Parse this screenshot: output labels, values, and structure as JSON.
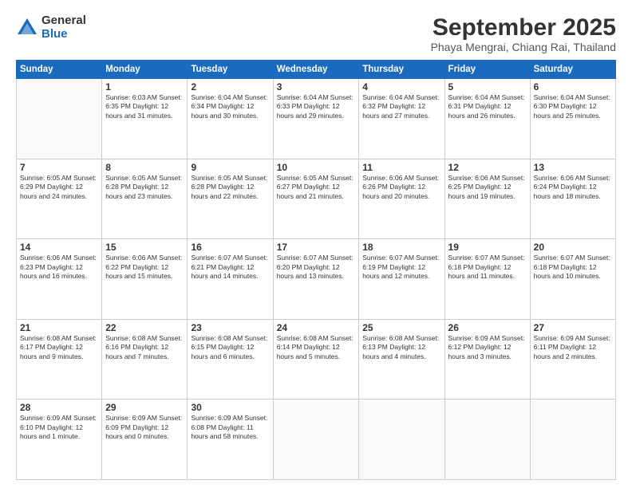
{
  "logo": {
    "general": "General",
    "blue": "Blue"
  },
  "header": {
    "month": "September 2025",
    "location": "Phaya Mengrai, Chiang Rai, Thailand"
  },
  "weekdays": [
    "Sunday",
    "Monday",
    "Tuesday",
    "Wednesday",
    "Thursday",
    "Friday",
    "Saturday"
  ],
  "weeks": [
    [
      {
        "day": "",
        "detail": ""
      },
      {
        "day": "1",
        "detail": "Sunrise: 6:03 AM\nSunset: 6:35 PM\nDaylight: 12 hours\nand 31 minutes."
      },
      {
        "day": "2",
        "detail": "Sunrise: 6:04 AM\nSunset: 6:34 PM\nDaylight: 12 hours\nand 30 minutes."
      },
      {
        "day": "3",
        "detail": "Sunrise: 6:04 AM\nSunset: 6:33 PM\nDaylight: 12 hours\nand 29 minutes."
      },
      {
        "day": "4",
        "detail": "Sunrise: 6:04 AM\nSunset: 6:32 PM\nDaylight: 12 hours\nand 27 minutes."
      },
      {
        "day": "5",
        "detail": "Sunrise: 6:04 AM\nSunset: 6:31 PM\nDaylight: 12 hours\nand 26 minutes."
      },
      {
        "day": "6",
        "detail": "Sunrise: 6:04 AM\nSunset: 6:30 PM\nDaylight: 12 hours\nand 25 minutes."
      }
    ],
    [
      {
        "day": "7",
        "detail": "Sunrise: 6:05 AM\nSunset: 6:29 PM\nDaylight: 12 hours\nand 24 minutes."
      },
      {
        "day": "8",
        "detail": "Sunrise: 6:05 AM\nSunset: 6:28 PM\nDaylight: 12 hours\nand 23 minutes."
      },
      {
        "day": "9",
        "detail": "Sunrise: 6:05 AM\nSunset: 6:28 PM\nDaylight: 12 hours\nand 22 minutes."
      },
      {
        "day": "10",
        "detail": "Sunrise: 6:05 AM\nSunset: 6:27 PM\nDaylight: 12 hours\nand 21 minutes."
      },
      {
        "day": "11",
        "detail": "Sunrise: 6:06 AM\nSunset: 6:26 PM\nDaylight: 12 hours\nand 20 minutes."
      },
      {
        "day": "12",
        "detail": "Sunrise: 6:06 AM\nSunset: 6:25 PM\nDaylight: 12 hours\nand 19 minutes."
      },
      {
        "day": "13",
        "detail": "Sunrise: 6:06 AM\nSunset: 6:24 PM\nDaylight: 12 hours\nand 18 minutes."
      }
    ],
    [
      {
        "day": "14",
        "detail": "Sunrise: 6:06 AM\nSunset: 6:23 PM\nDaylight: 12 hours\nand 16 minutes."
      },
      {
        "day": "15",
        "detail": "Sunrise: 6:06 AM\nSunset: 6:22 PM\nDaylight: 12 hours\nand 15 minutes."
      },
      {
        "day": "16",
        "detail": "Sunrise: 6:07 AM\nSunset: 6:21 PM\nDaylight: 12 hours\nand 14 minutes."
      },
      {
        "day": "17",
        "detail": "Sunrise: 6:07 AM\nSunset: 6:20 PM\nDaylight: 12 hours\nand 13 minutes."
      },
      {
        "day": "18",
        "detail": "Sunrise: 6:07 AM\nSunset: 6:19 PM\nDaylight: 12 hours\nand 12 minutes."
      },
      {
        "day": "19",
        "detail": "Sunrise: 6:07 AM\nSunset: 6:18 PM\nDaylight: 12 hours\nand 11 minutes."
      },
      {
        "day": "20",
        "detail": "Sunrise: 6:07 AM\nSunset: 6:18 PM\nDaylight: 12 hours\nand 10 minutes."
      }
    ],
    [
      {
        "day": "21",
        "detail": "Sunrise: 6:08 AM\nSunset: 6:17 PM\nDaylight: 12 hours\nand 9 minutes."
      },
      {
        "day": "22",
        "detail": "Sunrise: 6:08 AM\nSunset: 6:16 PM\nDaylight: 12 hours\nand 7 minutes."
      },
      {
        "day": "23",
        "detail": "Sunrise: 6:08 AM\nSunset: 6:15 PM\nDaylight: 12 hours\nand 6 minutes."
      },
      {
        "day": "24",
        "detail": "Sunrise: 6:08 AM\nSunset: 6:14 PM\nDaylight: 12 hours\nand 5 minutes."
      },
      {
        "day": "25",
        "detail": "Sunrise: 6:08 AM\nSunset: 6:13 PM\nDaylight: 12 hours\nand 4 minutes."
      },
      {
        "day": "26",
        "detail": "Sunrise: 6:09 AM\nSunset: 6:12 PM\nDaylight: 12 hours\nand 3 minutes."
      },
      {
        "day": "27",
        "detail": "Sunrise: 6:09 AM\nSunset: 6:11 PM\nDaylight: 12 hours\nand 2 minutes."
      }
    ],
    [
      {
        "day": "28",
        "detail": "Sunrise: 6:09 AM\nSunset: 6:10 PM\nDaylight: 12 hours\nand 1 minute."
      },
      {
        "day": "29",
        "detail": "Sunrise: 6:09 AM\nSunset: 6:09 PM\nDaylight: 12 hours\nand 0 minutes."
      },
      {
        "day": "30",
        "detail": "Sunrise: 6:09 AM\nSunset: 6:08 PM\nDaylight: 11 hours\nand 58 minutes."
      },
      {
        "day": "",
        "detail": ""
      },
      {
        "day": "",
        "detail": ""
      },
      {
        "day": "",
        "detail": ""
      },
      {
        "day": "",
        "detail": ""
      }
    ]
  ]
}
